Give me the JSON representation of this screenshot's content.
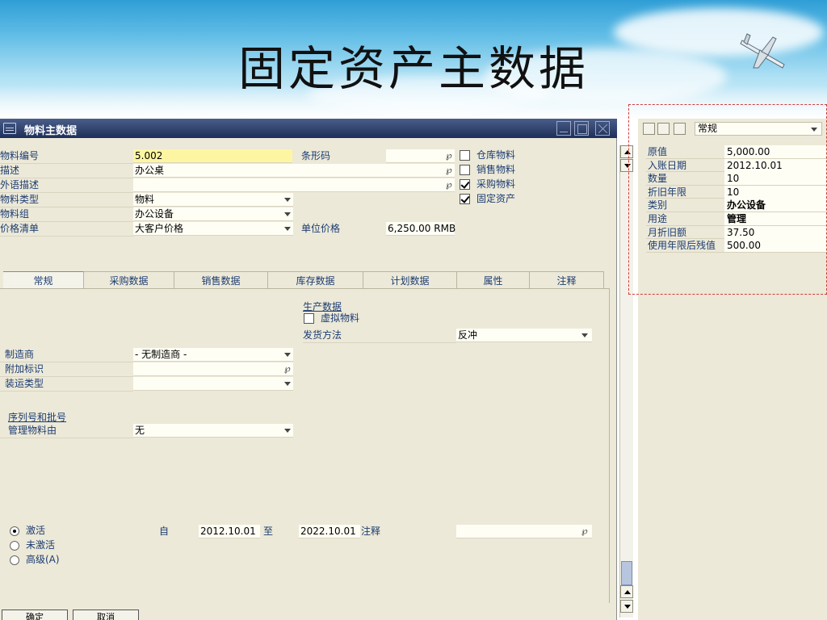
{
  "slide": {
    "title": "固定资产主数据"
  },
  "window": {
    "title": "物料主数据"
  },
  "header": {
    "item_code_label": "物料编号",
    "item_code": "5.002",
    "desc_label": "描述",
    "desc": "办公桌",
    "foreign_desc_label": "外语描述",
    "foreign_desc": "",
    "item_type_label": "物料类型",
    "item_type": "物料",
    "item_group_label": "物料组",
    "item_group": "办公设备",
    "price_list_label": "价格清单",
    "price_list": "大客户价格",
    "barcode_label": "条形码",
    "barcode": "",
    "unit_price_label": "单位价格",
    "unit_price": "6,250.00 RMB"
  },
  "checkboxes": [
    {
      "label": "仓库物料",
      "checked": false
    },
    {
      "label": "销售物料",
      "checked": false
    },
    {
      "label": "采购物料",
      "checked": true
    },
    {
      "label": "固定资产",
      "checked": true
    }
  ],
  "tabs": [
    "常规",
    "采购数据",
    "销售数据",
    "库存数据",
    "计划数据",
    "属性",
    "注释"
  ],
  "general": {
    "production_title": "生产数据",
    "phantom_label": "虚拟物料",
    "issue_method_label": "发货方法",
    "issue_method": "反冲",
    "manufacturer_label": "制造商",
    "manufacturer": "- 无制造商 -",
    "additional_id_label": "附加标识",
    "additional_id": "",
    "shipping_type_label": "装运类型",
    "shipping_type": "",
    "serial_title": "序列号和批号",
    "manage_by_label": "管理物料由",
    "manage_by": "无"
  },
  "status": {
    "active_label": "激活",
    "inactive_label": "未激活",
    "advanced_label": "高级(A)",
    "from_label": "自",
    "from_date": "2012.10.01",
    "to_label": "至",
    "to_date": "2022.10.01",
    "remarks_label": "注释",
    "remarks": ""
  },
  "buttons": {
    "ok": "确定",
    "cancel": "取消"
  },
  "right_panel": {
    "selector": "常规",
    "rows": [
      {
        "label": "原值",
        "value": "5,000.00"
      },
      {
        "label": "入账日期",
        "value": "2012.10.01"
      },
      {
        "label": "数量",
        "value": "10"
      },
      {
        "label": "折旧年限",
        "value": "10"
      },
      {
        "label": "类别",
        "value": "办公设备"
      },
      {
        "label": "用途",
        "value": "管理"
      },
      {
        "label": "月折旧额",
        "value": "37.50"
      },
      {
        "label": "使用年限后残值",
        "value": "500.00"
      }
    ]
  }
}
